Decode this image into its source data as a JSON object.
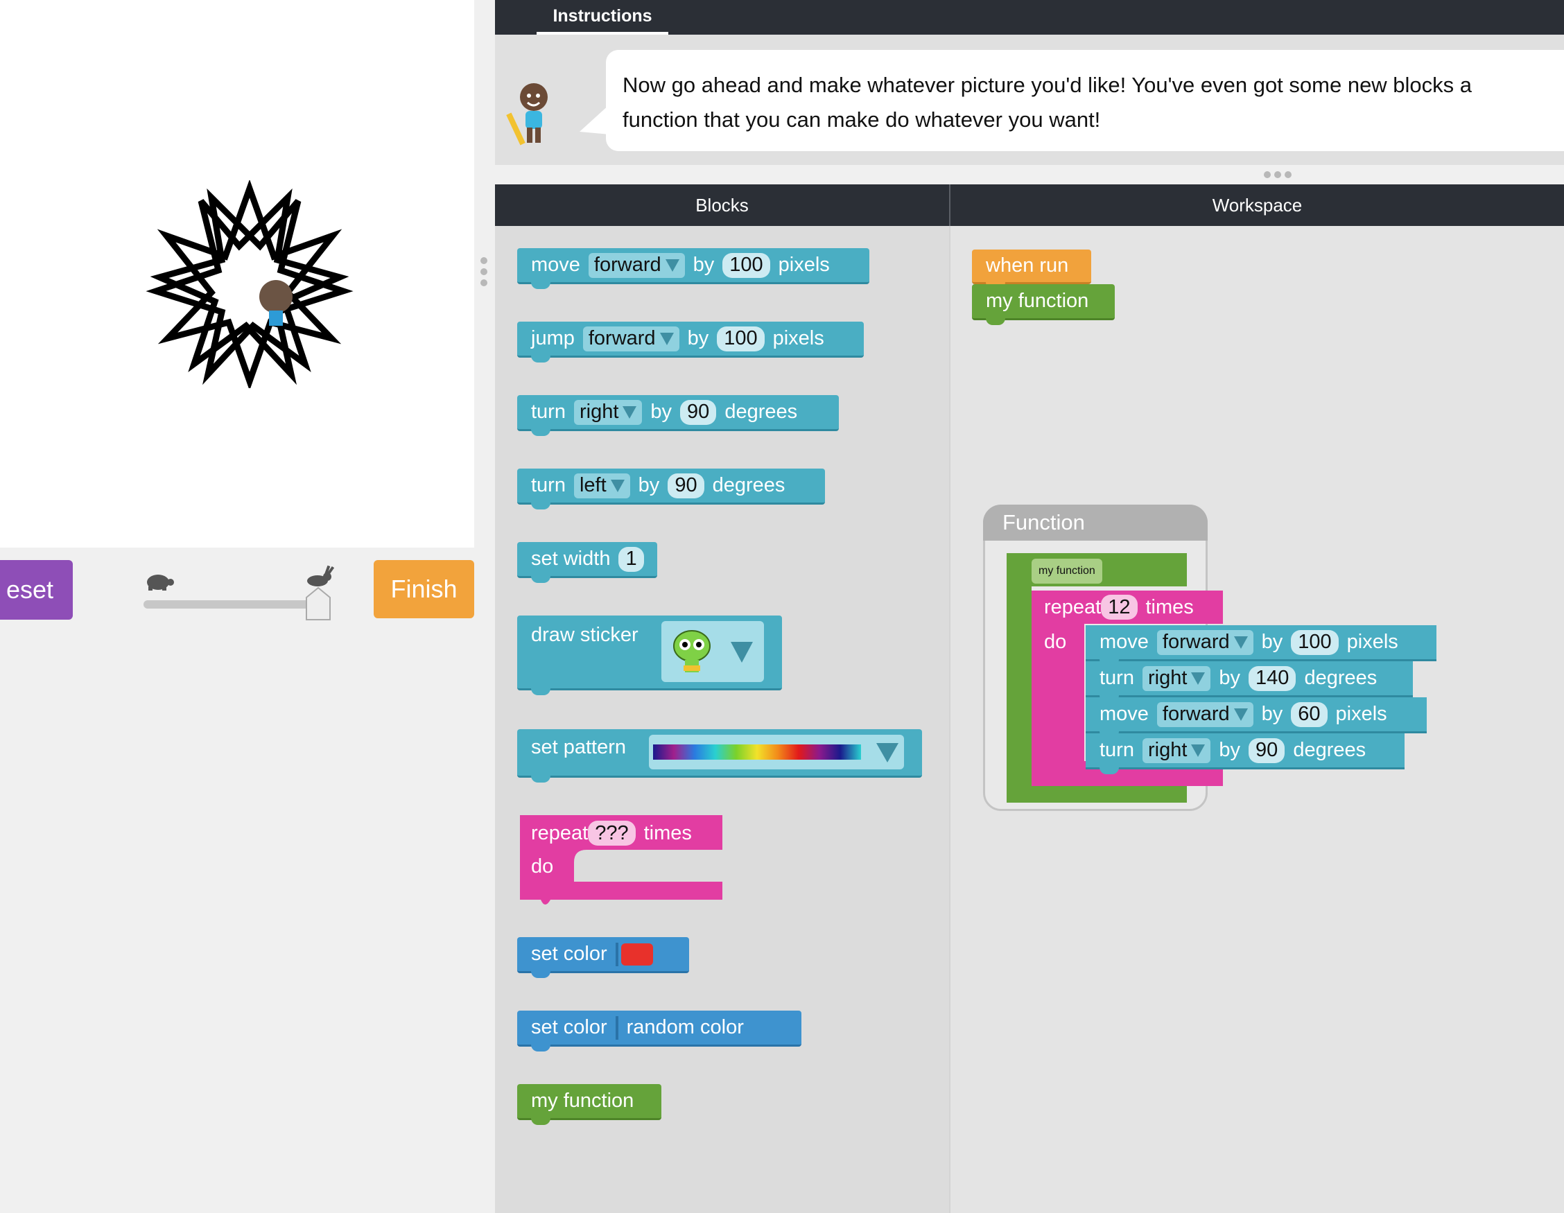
{
  "controls": {
    "reset_label": "eset",
    "finish_label": "Finish"
  },
  "instructions": {
    "tab_label": "Instructions",
    "line1": "Now go ahead and make whatever picture you'd like! You've even got some new blocks a",
    "line2": "function that you can make do whatever you want!"
  },
  "headers": {
    "blocks": "Blocks",
    "workspace": "Workspace"
  },
  "toolbox": {
    "move": {
      "w1": "move",
      "dir": "forward",
      "by": "by",
      "num": "100",
      "unit": "pixels"
    },
    "jump": {
      "w1": "jump",
      "dir": "forward",
      "by": "by",
      "num": "100",
      "unit": "pixels"
    },
    "turn_right": {
      "w1": "turn",
      "dir": "right",
      "by": "by",
      "num": "90",
      "unit": "degrees"
    },
    "turn_left": {
      "w1": "turn",
      "dir": "left",
      "by": "by",
      "num": "90",
      "unit": "degrees"
    },
    "set_width": {
      "w1": "set width",
      "num": "1"
    },
    "draw_sticker": {
      "w1": "draw sticker"
    },
    "set_pattern": {
      "w1": "set pattern"
    },
    "repeat": {
      "w1": "repeat",
      "num": "???",
      "w2": "times",
      "do": "do"
    },
    "set_color": {
      "w1": "set color",
      "color": "#e8312b"
    },
    "set_color_random": {
      "w1": "set color",
      "value": "random color"
    },
    "my_function": {
      "w1": "my function"
    }
  },
  "workspace": {
    "when_run": "when run",
    "call": "my function",
    "function_label": "Function",
    "def_name": "my function",
    "repeat": {
      "w1": "repeat",
      "num": "12",
      "w2": "times",
      "do": "do"
    },
    "steps": [
      {
        "w1": "move",
        "dir": "forward",
        "by": "by",
        "num": "100",
        "unit": "pixels"
      },
      {
        "w1": "turn",
        "dir": "right",
        "by": "by",
        "num": "140",
        "unit": "degrees"
      },
      {
        "w1": "move",
        "dir": "forward",
        "by": "by",
        "num": "60",
        "unit": "pixels"
      },
      {
        "w1": "turn",
        "dir": "right",
        "by": "by",
        "num": "90",
        "unit": "degrees"
      }
    ]
  },
  "colors": {
    "teal": "#4aaec3",
    "green": "#65a33a",
    "orange": "#f1a23c",
    "pink": "#e23da2",
    "purple": "#8e4eb7"
  }
}
